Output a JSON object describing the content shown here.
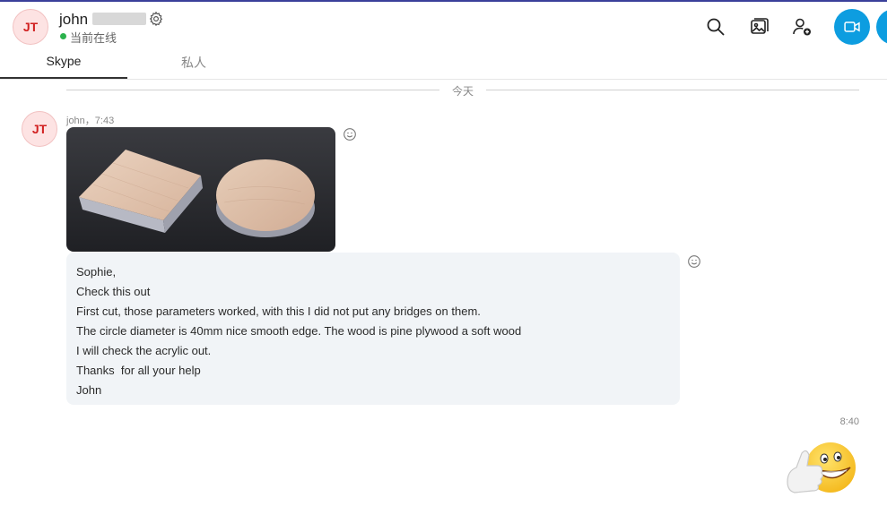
{
  "header": {
    "avatar_initials": "JT",
    "contact_name": "john",
    "status": "当前在线",
    "status_color": "#2bb24c",
    "icons": [
      "gear-icon",
      "search-icon",
      "gallery-icon",
      "add-person-icon",
      "video-call-icon"
    ]
  },
  "tabs": [
    {
      "label": "Skype",
      "active": true
    },
    {
      "label": "私人",
      "active": false
    }
  ],
  "chat": {
    "date_divider": "今天",
    "message1": {
      "avatar_initials": "JT",
      "meta": "john，7:43",
      "image": "photo of a square wood piece and a round wood disc on a dark surface"
    },
    "message2": {
      "lines": [
        "Sophie,",
        "Check this out",
        "First cut, those parameters worked, with this I did not put any bridges on them.",
        "The circle diameter is 40mm nice smooth edge. The wood is pine plywood a soft wood",
        "I will check the acrylic out.",
        "Thanks  for all your help",
        "John"
      ]
    },
    "message3": {
      "time": "8:40",
      "emoji": "thumbs-up-grin-emoji"
    }
  },
  "colors": {
    "accent": "#0d9de0",
    "avatar_bg": "#fde3e3",
    "avatar_text": "#d12020",
    "bubble_bg": "#f1f4f7"
  }
}
